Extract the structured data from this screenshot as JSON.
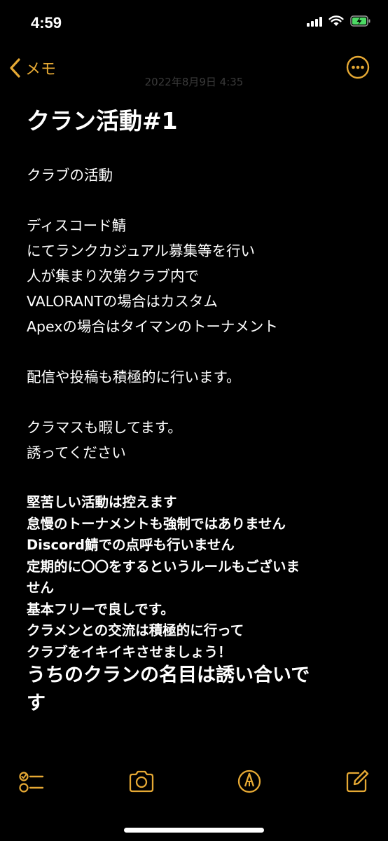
{
  "status_bar": {
    "time": "4:59"
  },
  "nav": {
    "back_label": "メモ"
  },
  "note": {
    "date": "2022年8月9日 4:35",
    "title": "クラン活動#1",
    "body_lines": [
      "クラブの活動",
      "",
      "ディスコード鯖",
      "にてランクカジュアル募集等を行い",
      "人が集まり次第クラブ内で",
      "VALORANTの場合はカスタム",
      "Apexの場合はタイマンのトーナメント",
      "",
      "配信や投稿も積極的に行います。",
      "",
      "クラマスも暇してます。",
      "誘ってください"
    ],
    "bold_lines": [
      "堅苦しい活動は控えます",
      "怠慢のトーナメントも強制ではありません",
      "Discord鯖での点呼も行いません",
      "定期的に〇〇をするというルールもございま",
      "せん",
      "基本フリーで良しです。",
      "クラメンとの交流は積極的に行って",
      "クラブをイキイキさせましょう！"
    ],
    "big_lines": [
      "うちのクランの名目は誘い合いで",
      "す"
    ]
  },
  "colors": {
    "accent": "#e6a934",
    "background": "#000000",
    "text": "#ffffff"
  },
  "icons": {
    "back": "chevron-left-icon",
    "more": "more-ellipsis-icon",
    "checklist": "checklist-icon",
    "camera": "camera-icon",
    "markup": "markup-pen-icon",
    "compose": "compose-icon"
  }
}
